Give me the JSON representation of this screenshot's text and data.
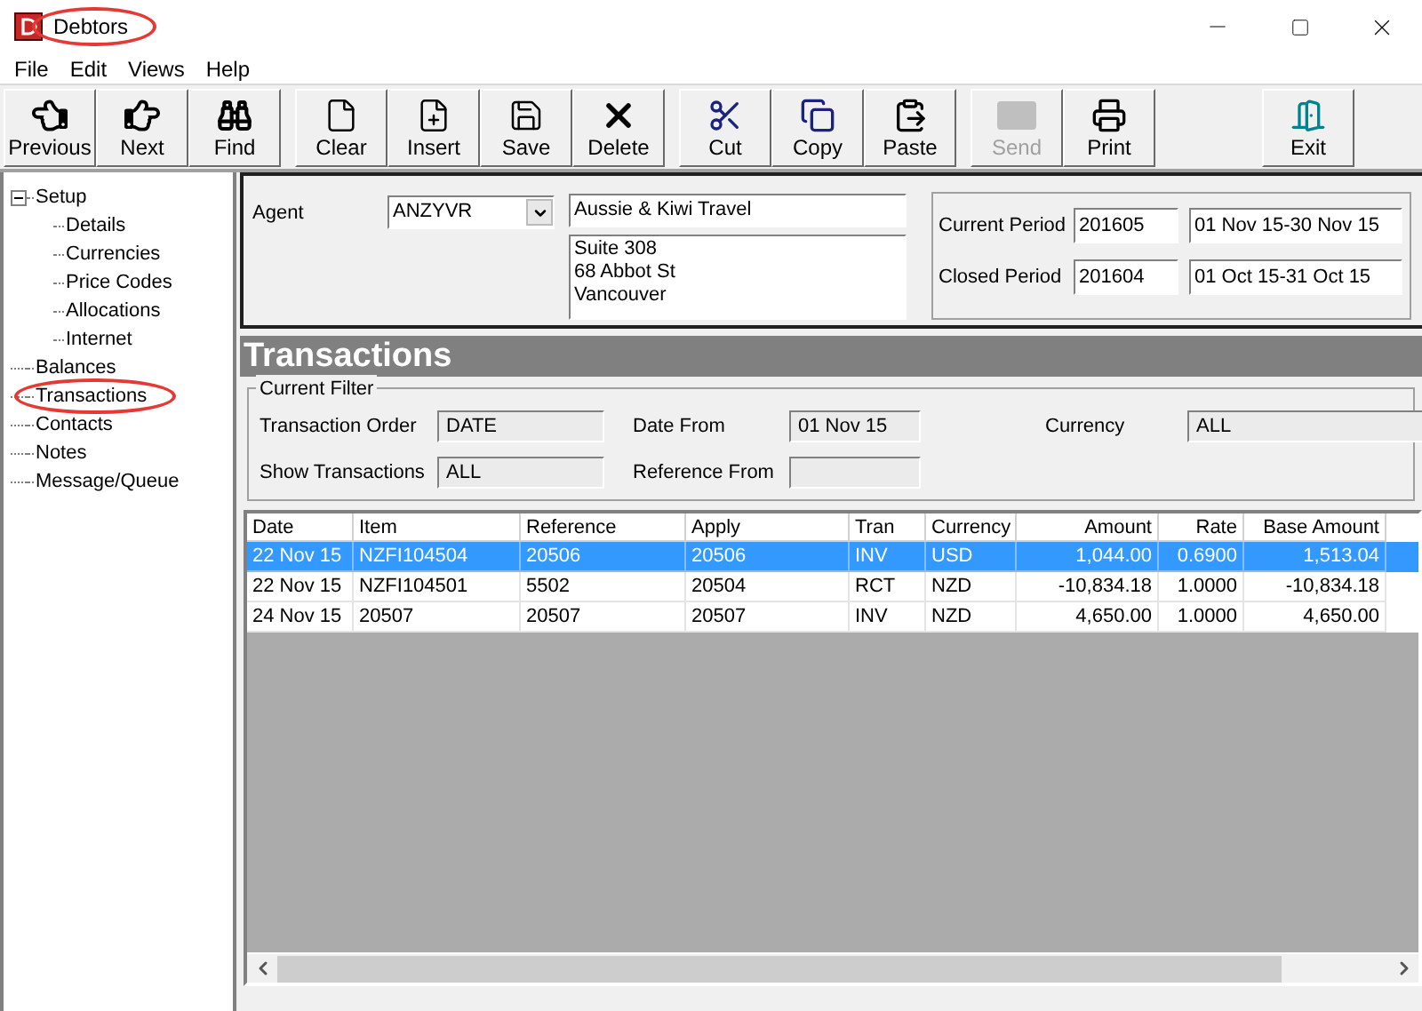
{
  "window": {
    "title": "Debtors",
    "circled": true
  },
  "menu": [
    "File",
    "Edit",
    "Views",
    "Help"
  ],
  "toolbar": [
    {
      "kind": "previous",
      "label": "Previous",
      "disabled": false
    },
    {
      "kind": "next",
      "label": "Next",
      "disabled": false
    },
    {
      "kind": "find",
      "label": "Find",
      "disabled": false
    },
    {
      "kind": "clear",
      "label": "Clear",
      "disabled": false
    },
    {
      "kind": "insert",
      "label": "Insert",
      "disabled": false
    },
    {
      "kind": "save",
      "label": "Save",
      "disabled": false
    },
    {
      "kind": "delete",
      "label": "Delete",
      "disabled": false
    },
    {
      "kind": "cut",
      "label": "Cut",
      "disabled": false
    },
    {
      "kind": "copy",
      "label": "Copy",
      "disabled": false
    },
    {
      "kind": "paste",
      "label": "Paste",
      "disabled": false
    },
    {
      "kind": "send",
      "label": "Send",
      "disabled": true
    },
    {
      "kind": "print",
      "label": "Print",
      "disabled": false
    },
    {
      "kind": "exit",
      "label": "Exit",
      "disabled": false
    }
  ],
  "tree": [
    {
      "label": "Setup",
      "expanded": true,
      "circled": false,
      "children": [
        {
          "label": "Details",
          "circled": false
        },
        {
          "label": "Currencies",
          "circled": false
        },
        {
          "label": "Price Codes",
          "circled": false
        },
        {
          "label": "Allocations",
          "circled": false
        },
        {
          "label": "Internet",
          "circled": false
        }
      ]
    },
    {
      "label": "Balances",
      "circled": false
    },
    {
      "label": "Transactions",
      "circled": true
    },
    {
      "label": "Contacts",
      "circled": false
    },
    {
      "label": "Notes",
      "circled": false
    },
    {
      "label": "Message/Queue",
      "circled": false
    }
  ],
  "agent": {
    "label": "Agent",
    "code": "ANZYVR",
    "name": "Aussie & Kiwi Travel",
    "address": [
      "Suite 308",
      "68 Abbot St",
      "Vancouver"
    ]
  },
  "periods": [
    {
      "label": "Current Period",
      "code": "201605",
      "range": "01 Nov 15-30 Nov 15"
    },
    {
      "label": "Closed Period",
      "code": "201604",
      "range": "01 Oct 15-31 Oct 15"
    }
  ],
  "section_title": "Transactions",
  "filter": {
    "title": "Current Filter",
    "fields": [
      {
        "label": "Transaction Order",
        "value": "DATE"
      },
      {
        "label": "Date From",
        "value": "01 Nov 15"
      },
      {
        "label": "Currency",
        "value": "ALL"
      },
      {
        "label": "Show Transactions",
        "value": "ALL"
      },
      {
        "label": "Reference From"
      }
    ]
  },
  "table": {
    "columns": [
      "Date",
      "Item",
      "Reference",
      "Apply",
      "Tran",
      "Currency",
      "Amount",
      "Rate",
      "Base Amount"
    ],
    "rows": [
      {
        "selected": true,
        "cells": [
          "22 Nov 15",
          "NZFI104504",
          "20506",
          "20506",
          "INV",
          "USD",
          "1,044.00",
          "0.6900",
          "1,513.04"
        ]
      },
      {
        "selected": false,
        "cells": [
          "22 Nov 15",
          "NZFI104501",
          "5502",
          "20504",
          "RCT",
          "NZD",
          "-10,834.18",
          "1.0000",
          "-10,834.18"
        ]
      },
      {
        "selected": false,
        "cells": [
          "24 Nov 15",
          "20507",
          "20507",
          "20507",
          "INV",
          "NZD",
          "4,650.00",
          "1.0000",
          "4,650.00"
        ]
      }
    ]
  }
}
